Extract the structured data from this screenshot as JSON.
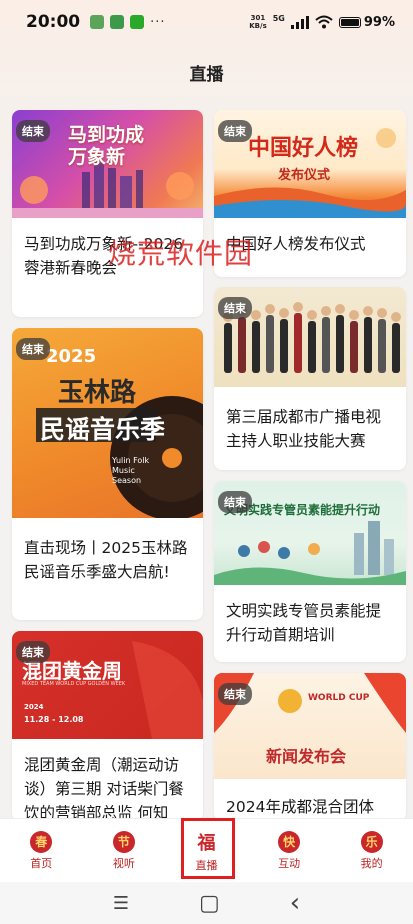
{
  "status_bar": {
    "time": "20:00",
    "net_speed": "301",
    "net_unit": "KB/s",
    "net_type": "5G",
    "battery": "99%",
    "more": "···"
  },
  "page_title": "直播",
  "cards": [
    {
      "badge": "结束",
      "title": "马到功成万象新--2026蓉港新春晚会",
      "thumb_text": "马到功成万象新"
    },
    {
      "badge": "结束",
      "title": "中国好人榜发布仪式",
      "thumb_text": "中国好人榜",
      "thumb_sub": "发布仪式"
    },
    {
      "badge": "结束",
      "title": "第三届成都市广播电视主持人职业技能大赛"
    },
    {
      "badge": "结束",
      "title": "直击现场丨2025玉林路民谣音乐季盛大启航!",
      "thumb_year": "2025",
      "thumb_text_1": "玉林路",
      "thumb_text_2": "民谣音乐季",
      "thumb_en": "Yulin Folk Music Season"
    },
    {
      "badge": "结束",
      "title": "文明实践专管员素能提升行动首期培训",
      "thumb_text": "文明实践专管员素能提升行动"
    },
    {
      "badge": "结束",
      "title": "混团黄金周（潮运动访谈）第三期 对话柴门餐饮的营销部总监 何知",
      "thumb_text": "混团黄金周",
      "thumb_sub": "MIXED TEAM WORLD CUP GOLDEN WEEK",
      "thumb_year": "2024",
      "thumb_date": "11.28 - 12.08"
    },
    {
      "badge": "结束",
      "title": "2024年成都混合团体",
      "thumb_text": "新闻发布会",
      "thumb_en": "WORLD CUP"
    }
  ],
  "watermark": "烧荒软件园",
  "bottom_nav": [
    {
      "icon": "春",
      "label": "首页"
    },
    {
      "icon": "节",
      "label": "视听"
    },
    {
      "icon": "福",
      "label": "直播"
    },
    {
      "icon": "快",
      "label": "互动"
    },
    {
      "icon": "乐",
      "label": "我的"
    }
  ],
  "system_nav": {
    "menu": "☰",
    "home": "▢",
    "back": "‹"
  }
}
